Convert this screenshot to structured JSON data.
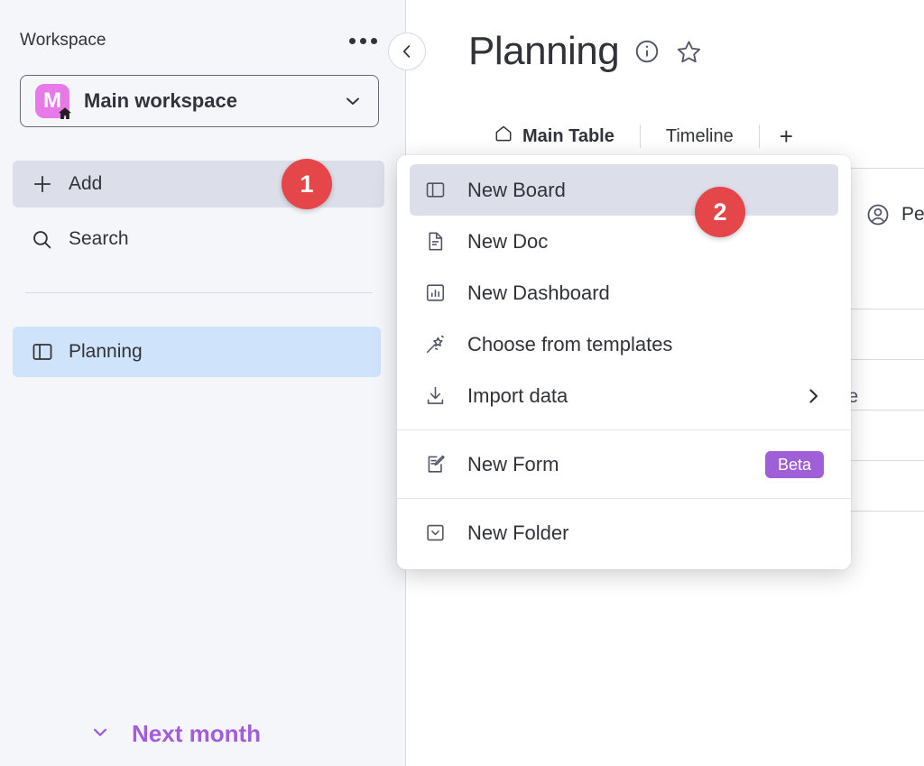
{
  "sidebar": {
    "section_title": "Workspace",
    "more_options_label": "More options",
    "workspace": {
      "avatar_initial": "M",
      "name": "Main workspace",
      "avatar_color": "#e879e8",
      "home_badge_icon": "home-icon"
    },
    "rows": [
      {
        "icon": "plus-icon",
        "label": "Add",
        "state": "highlighted"
      },
      {
        "icon": "search-icon",
        "label": "Search",
        "state": "default"
      }
    ],
    "boards": [
      {
        "icon": "board-icon",
        "label": "Planning",
        "state": "selected"
      }
    ],
    "background_color": "#f5f6fa",
    "selected_board_color": "#cfe3fb",
    "highlight_color": "#dcdfea"
  },
  "header": {
    "collapse_icon": "chevron-left-icon",
    "title": "Planning",
    "info_icon": "info-icon",
    "favorite_icon": "star-icon",
    "tabs": [
      {
        "icon": "home-icon",
        "label": "Main Table",
        "active": true
      },
      {
        "icon": "",
        "label": "Timeline",
        "active": false
      }
    ],
    "add_tab_label": "+"
  },
  "board": {
    "person_column_header": "Pe",
    "partial_cell_text": "ve",
    "next_month": {
      "chevron_icon": "chevron-down-icon",
      "label": "Next month",
      "color": "#a25ddc"
    }
  },
  "menu": {
    "groups": [
      {
        "items": [
          {
            "icon": "board-icon",
            "label": "New Board",
            "selected": true,
            "badge": "",
            "submenu": false
          },
          {
            "icon": "doc-icon",
            "label": "New Doc",
            "selected": false,
            "badge": "",
            "submenu": false
          },
          {
            "icon": "dashboard-icon",
            "label": "New Dashboard",
            "selected": false,
            "badge": "",
            "submenu": false
          },
          {
            "icon": "wand-icon",
            "label": "Choose from templates",
            "selected": false,
            "badge": "",
            "submenu": false
          },
          {
            "icon": "import-icon",
            "label": "Import data",
            "selected": false,
            "badge": "",
            "submenu": true
          }
        ]
      },
      {
        "items": [
          {
            "icon": "form-icon",
            "label": "New Form",
            "selected": false,
            "badge": "Beta",
            "submenu": false
          }
        ]
      },
      {
        "items": [
          {
            "icon": "folder-icon",
            "label": "New Folder",
            "selected": false,
            "badge": "",
            "submenu": false
          }
        ]
      }
    ],
    "selected_color": "#dcdfea",
    "beta_badge_color": "#9f5fd6"
  },
  "step_badges": [
    {
      "number": "1",
      "target": "add-button"
    },
    {
      "number": "2",
      "target": "menu-item-new-board"
    }
  ],
  "colors": {
    "badge_red": "#e4464a",
    "accent_purple": "#a25ddc",
    "text": "#323338"
  }
}
